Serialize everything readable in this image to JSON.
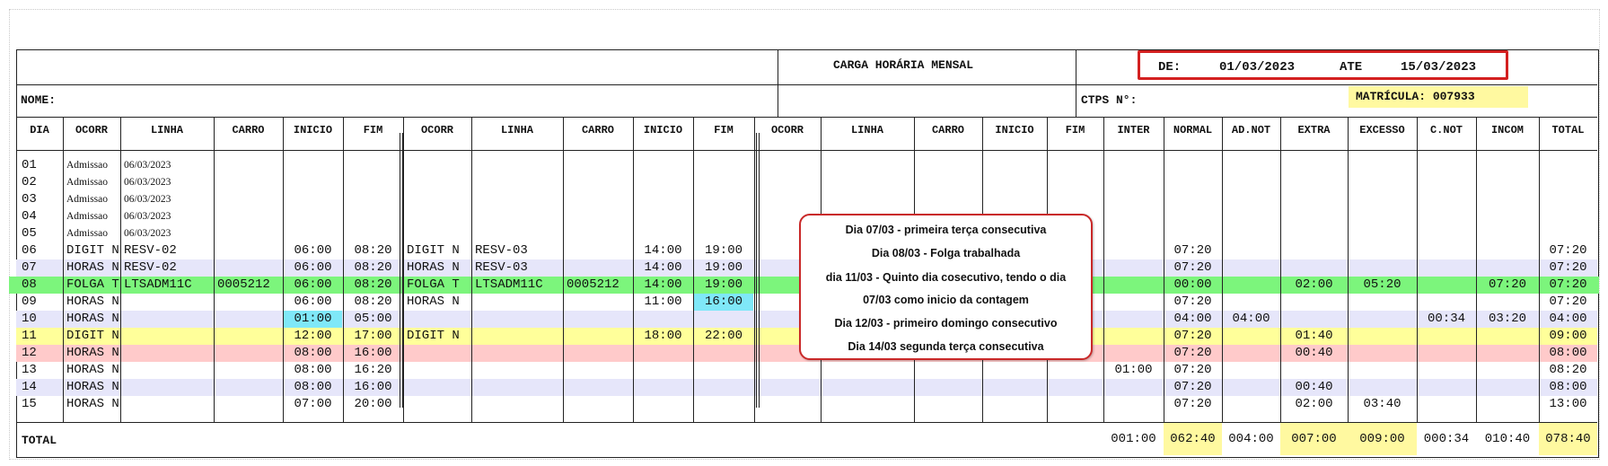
{
  "header": {
    "title": "CARGA HORÁRIA MENSAL",
    "de_label": "DE:",
    "de_value": "01/03/2023",
    "ate_label": "ATE",
    "ate_value": "15/03/2023",
    "nome_label": "NOME:",
    "ctps_label": "CTPS N°:",
    "matricula": "MATRÍCULA: 007933"
  },
  "columns": [
    "DIA",
    "OCORR",
    "LINHA",
    "CARRO",
    "INICIO",
    "FIM",
    "OCORR",
    "LINHA",
    "CARRO",
    "INICIO",
    "FIM",
    "OCORR",
    "LINHA",
    "CARRO",
    "INICIO",
    "FIM",
    "INTER",
    "NORMAL",
    "AD.NOT",
    "EXTRA",
    "EXCESSO",
    "C.NOT",
    "INCOM",
    "TOTAL"
  ],
  "rows": [
    {
      "dia": "01",
      "ocorr1": "Admissao",
      "linha1": "06/03/2023"
    },
    {
      "dia": "02",
      "ocorr1": "Admissao",
      "linha1": "06/03/2023"
    },
    {
      "dia": "03",
      "ocorr1": "Admissao",
      "linha1": "06/03/2023"
    },
    {
      "dia": "04",
      "ocorr1": "Admissao",
      "linha1": "06/03/2023"
    },
    {
      "dia": "05",
      "ocorr1": "Admissao",
      "linha1": "06/03/2023"
    },
    {
      "dia": "06",
      "ocorr1": "DIGIT N",
      "linha1": "RESV-02",
      "inicio1": "06:00",
      "fim1": "08:20",
      "ocorr2": "DIGIT N",
      "linha2": "RESV-03",
      "inicio2": "14:00",
      "fim2": "19:00",
      "normal": "07:20",
      "total": "07:20"
    },
    {
      "dia": "07",
      "ocorr1": "HORAS N",
      "linha1": "RESV-02",
      "inicio1": "06:00",
      "fim1": "08:20",
      "ocorr2": "HORAS N",
      "linha2": "RESV-03",
      "inicio2": "14:00",
      "fim2": "19:00",
      "normal": "07:20",
      "total": "07:20"
    },
    {
      "dia": "08",
      "ocorr1": "FOLGA T",
      "linha1": "LTSADM11C",
      "carro1": "0005212",
      "inicio1": "06:00",
      "fim1": "08:20",
      "ocorr2": "FOLGA T",
      "linha2": "LTSADM11C",
      "carro2": "0005212",
      "inicio2": "14:00",
      "fim2": "19:00",
      "normal": "00:00",
      "extra": "02:00",
      "excesso": "05:20",
      "incom": "07:20",
      "total": "07:20"
    },
    {
      "dia": "09",
      "ocorr1": "HORAS N",
      "inicio1": "06:00",
      "fim1": "08:20",
      "ocorr2": "HORAS N",
      "inicio2": "11:00",
      "fim2": "16:00",
      "normal": "07:20",
      "total": "07:20"
    },
    {
      "dia": "10",
      "ocorr1": "HORAS N",
      "inicio1": "01:00",
      "fim1": "05:00",
      "normal": "04:00",
      "adnot": "04:00",
      "cnot": "00:34",
      "incom": "03:20",
      "total": "04:00"
    },
    {
      "dia": "11",
      "ocorr1": "DIGIT N",
      "inicio1": "12:00",
      "fim1": "17:00",
      "ocorr2": "DIGIT N",
      "inicio2": "18:00",
      "fim2": "22:00",
      "normal": "07:20",
      "extra": "01:40",
      "total": "09:00"
    },
    {
      "dia": "12",
      "ocorr1": "HORAS N",
      "inicio1": "08:00",
      "fim1": "16:00",
      "normal": "07:20",
      "extra": "00:40",
      "total": "08:00"
    },
    {
      "dia": "13",
      "ocorr1": "HORAS N",
      "inicio1": "08:00",
      "fim1": "16:20",
      "inter": "01:00",
      "normal": "07:20",
      "total": "08:20"
    },
    {
      "dia": "14",
      "ocorr1": "HORAS N",
      "inicio1": "08:00",
      "fim1": "16:00",
      "normal": "07:20",
      "extra": "00:40",
      "total": "08:00"
    },
    {
      "dia": "15",
      "ocorr1": "HORAS N",
      "inicio1": "07:00",
      "fim1": "20:00",
      "normal": "07:20",
      "extra": "02:00",
      "excesso": "03:40",
      "total": "13:00"
    }
  ],
  "row_colors": {
    "blue": "#e6e6fa",
    "green": "#7cf57c",
    "yellow": "#ffff9a",
    "red": "#ffcaca",
    "cyan": "#7fe8f8"
  },
  "totals": {
    "label": "TOTAL",
    "inter": "001:00",
    "normal": "062:40",
    "adnot": "004:00",
    "extra": "007:00",
    "excesso": "009:00",
    "cnot": "000:34",
    "incom": "010:40",
    "total": "078:40"
  },
  "callout": {
    "line1": "Dia 07/03 - primeira terça consecutiva",
    "line2": "Dia 08/03 - Folga trabalhada",
    "line3": "dia 11/03 - Quinto dia cosecutivo, tendo o dia",
    "line4": "07/03 como inicio da contagem",
    "line5": "Dia 12/03 - primeiro domingo consecutivo",
    "line6": "Dia 14/03 segunda terça consecutiva"
  }
}
